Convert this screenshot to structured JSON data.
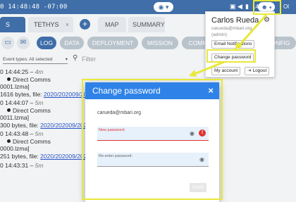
{
  "topbar": {
    "clock": "0 14:48:48 -07:00",
    "eye": "◉ ▾",
    "version": "14",
    "right": "Ol"
  },
  "platform_tabs": {
    "active_label": "S",
    "tethys_label": "TETHYS",
    "tethys_close": "×",
    "add_label": "+",
    "map_label": "MAP",
    "summary_label": "SUMMARY"
  },
  "sub_tabs": [
    "LOG",
    "DATA",
    "DEPLOYMENT",
    "MISSION",
    "COMM",
    "CONFIG"
  ],
  "filter": {
    "event_types_label": "Event types: All selected",
    "placeholder": "Filter"
  },
  "log_entries": [
    {
      "time": "0 14:44:25",
      "ago": "4m",
      "event": "Direct Comms",
      "file": "0001.lzma]",
      "size": "1616 bytes, file: ",
      "link": "2020/202009/20200"
    },
    {
      "time": "0 14:44:07",
      "ago": "5m",
      "event": "Direct Comms",
      "file": "0011.lzma]",
      "size": "300 bytes, file: ",
      "link": "2020/202009/20200"
    },
    {
      "time": "0 14:43:48",
      "ago": "5m",
      "event": "Direct Comms",
      "file": "0000.lzma]",
      "size": "251 bytes, file: ",
      "link": "2020/202009/20200"
    },
    {
      "time": "0 14:43:31",
      "ago": "5m",
      "event": "",
      "file": "",
      "size": "",
      "link": ""
    }
  ],
  "user_menu": {
    "name": "Carlos Rueda",
    "email": "carueda@mbari.org",
    "role": "(admin)",
    "email_notifications": "Email Notifications",
    "change_password": "Change password",
    "my_account": "My account",
    "logout": "Logout"
  },
  "modal": {
    "title": "Change password",
    "close": "×",
    "email": "carueda@mbari.org",
    "new_password_label": "New password:",
    "reenter_label": "Re-enter password:",
    "save": "SAVE"
  },
  "colors": {
    "topbar": "#3f6ea8",
    "modal_header": "#2f83e8",
    "highlight": "#e8e83a",
    "error": "#d33333"
  }
}
